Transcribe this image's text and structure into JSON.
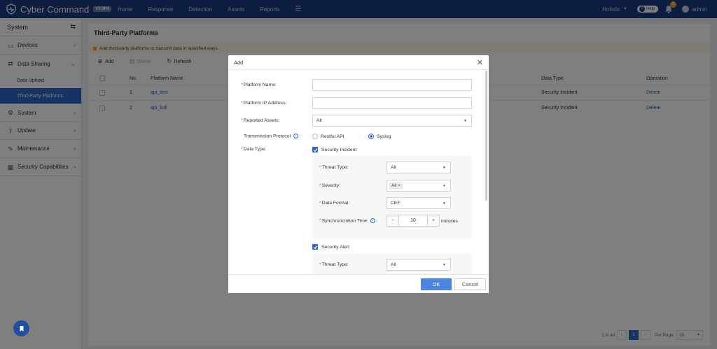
{
  "header": {
    "brand": "Cyber Command",
    "version": "V3.0R0",
    "nav": [
      "Home",
      "Response",
      "Detection",
      "Assets",
      "Reports"
    ],
    "scope": "Holistic",
    "help": "Help",
    "notification_count": "0",
    "user": "admin"
  },
  "sidebar": {
    "title": "System",
    "items": [
      {
        "label": "Devices"
      },
      {
        "label": "Data Sharing"
      },
      {
        "label": "System"
      },
      {
        "label": "Update"
      },
      {
        "label": "Maintenance"
      },
      {
        "label": "Security Capabilities"
      }
    ],
    "subitems": [
      "Data Upload",
      "Third-Party Platforms"
    ]
  },
  "page": {
    "title": "Third-Party Platforms",
    "notice": "Add third-party platforms to transmit data in specified ways.",
    "toolbar": {
      "add": "Add",
      "delete": "Delete",
      "refresh": "Refresh"
    },
    "columns": {
      "no": "No.",
      "name": "Platform Name",
      "data_type": "Data Type",
      "operation": "Operation"
    },
    "rows": [
      {
        "no": "1",
        "name": "api_test",
        "data_type": "Security Incident",
        "op": "Delete"
      },
      {
        "no": "2",
        "name": "api_kali",
        "data_type": "Security Incident",
        "op": "Delete"
      }
    ],
    "pager": {
      "total": "2 in all",
      "current": "1",
      "per_page_label": "Per Page",
      "per_page": "10"
    }
  },
  "modal": {
    "title": "Add",
    "platform_name_label": "Platform Name:",
    "platform_name_value": "",
    "platform_ip_label": "Platform IP Address:",
    "platform_ip_value": "",
    "reported_assets_label": "Reported Assets:",
    "reported_assets_value": "All",
    "protocol_label": "Transmission Protocol",
    "protocol_colon": ":",
    "protocol_options": [
      "Restful API",
      "Syslog"
    ],
    "data_type_label": "Data Type:",
    "incident": {
      "label": "Security Incident",
      "threat_type_label": "Threat Type:",
      "threat_type_value": "All",
      "severity_label": "Severity:",
      "severity_tag": "All",
      "data_format_label": "Data Format:",
      "data_format_value": "CEF",
      "sync_label": "Synchronization Time",
      "sync_colon": ":",
      "sync_value": "10",
      "sync_unit": "minutes"
    },
    "alert": {
      "label": "Security Alert",
      "threat_type_label": "Threat Type:",
      "threat_type_value": "All"
    },
    "ok": "OK",
    "cancel": "Cancel"
  }
}
